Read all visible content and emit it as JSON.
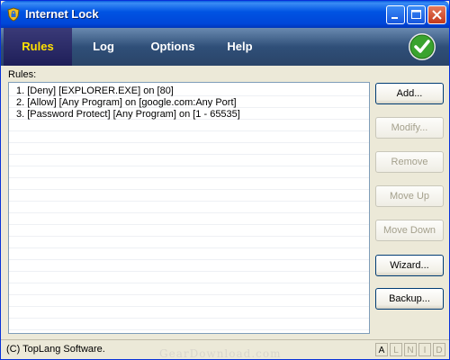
{
  "window": {
    "title": "Internet Lock"
  },
  "menu": {
    "rules": "Rules",
    "log": "Log",
    "options": "Options",
    "help": "Help"
  },
  "rules": {
    "label": "Rules:",
    "items": [
      "1. [Deny] [EXPLORER.EXE] on [80]",
      "2. [Allow] [Any Program] on [google.com:Any Port]",
      "3. [Password Protect] [Any Program] on [1 - 65535]"
    ]
  },
  "buttons": {
    "add": "Add...",
    "modify": "Modify...",
    "remove": "Remove",
    "move_up": "Move Up",
    "move_down": "Move Down",
    "wizard": "Wizard...",
    "backup": "Backup..."
  },
  "status": {
    "copyright": "(C) TopLang Software.",
    "watermark": "GearDownload.com",
    "indicators": [
      "A",
      "L",
      "N",
      "I",
      "D"
    ]
  },
  "colors": {
    "title_bar": "#0054e3",
    "menu_bar": "#2f4f78",
    "active_menu_text": "#ffe000",
    "ok_green": "#3aa32e"
  },
  "icons": {
    "app": "shield-lock-icon",
    "ok": "green-check-icon",
    "minimize": "minimize-icon",
    "maximize": "maximize-icon",
    "close": "close-icon"
  }
}
